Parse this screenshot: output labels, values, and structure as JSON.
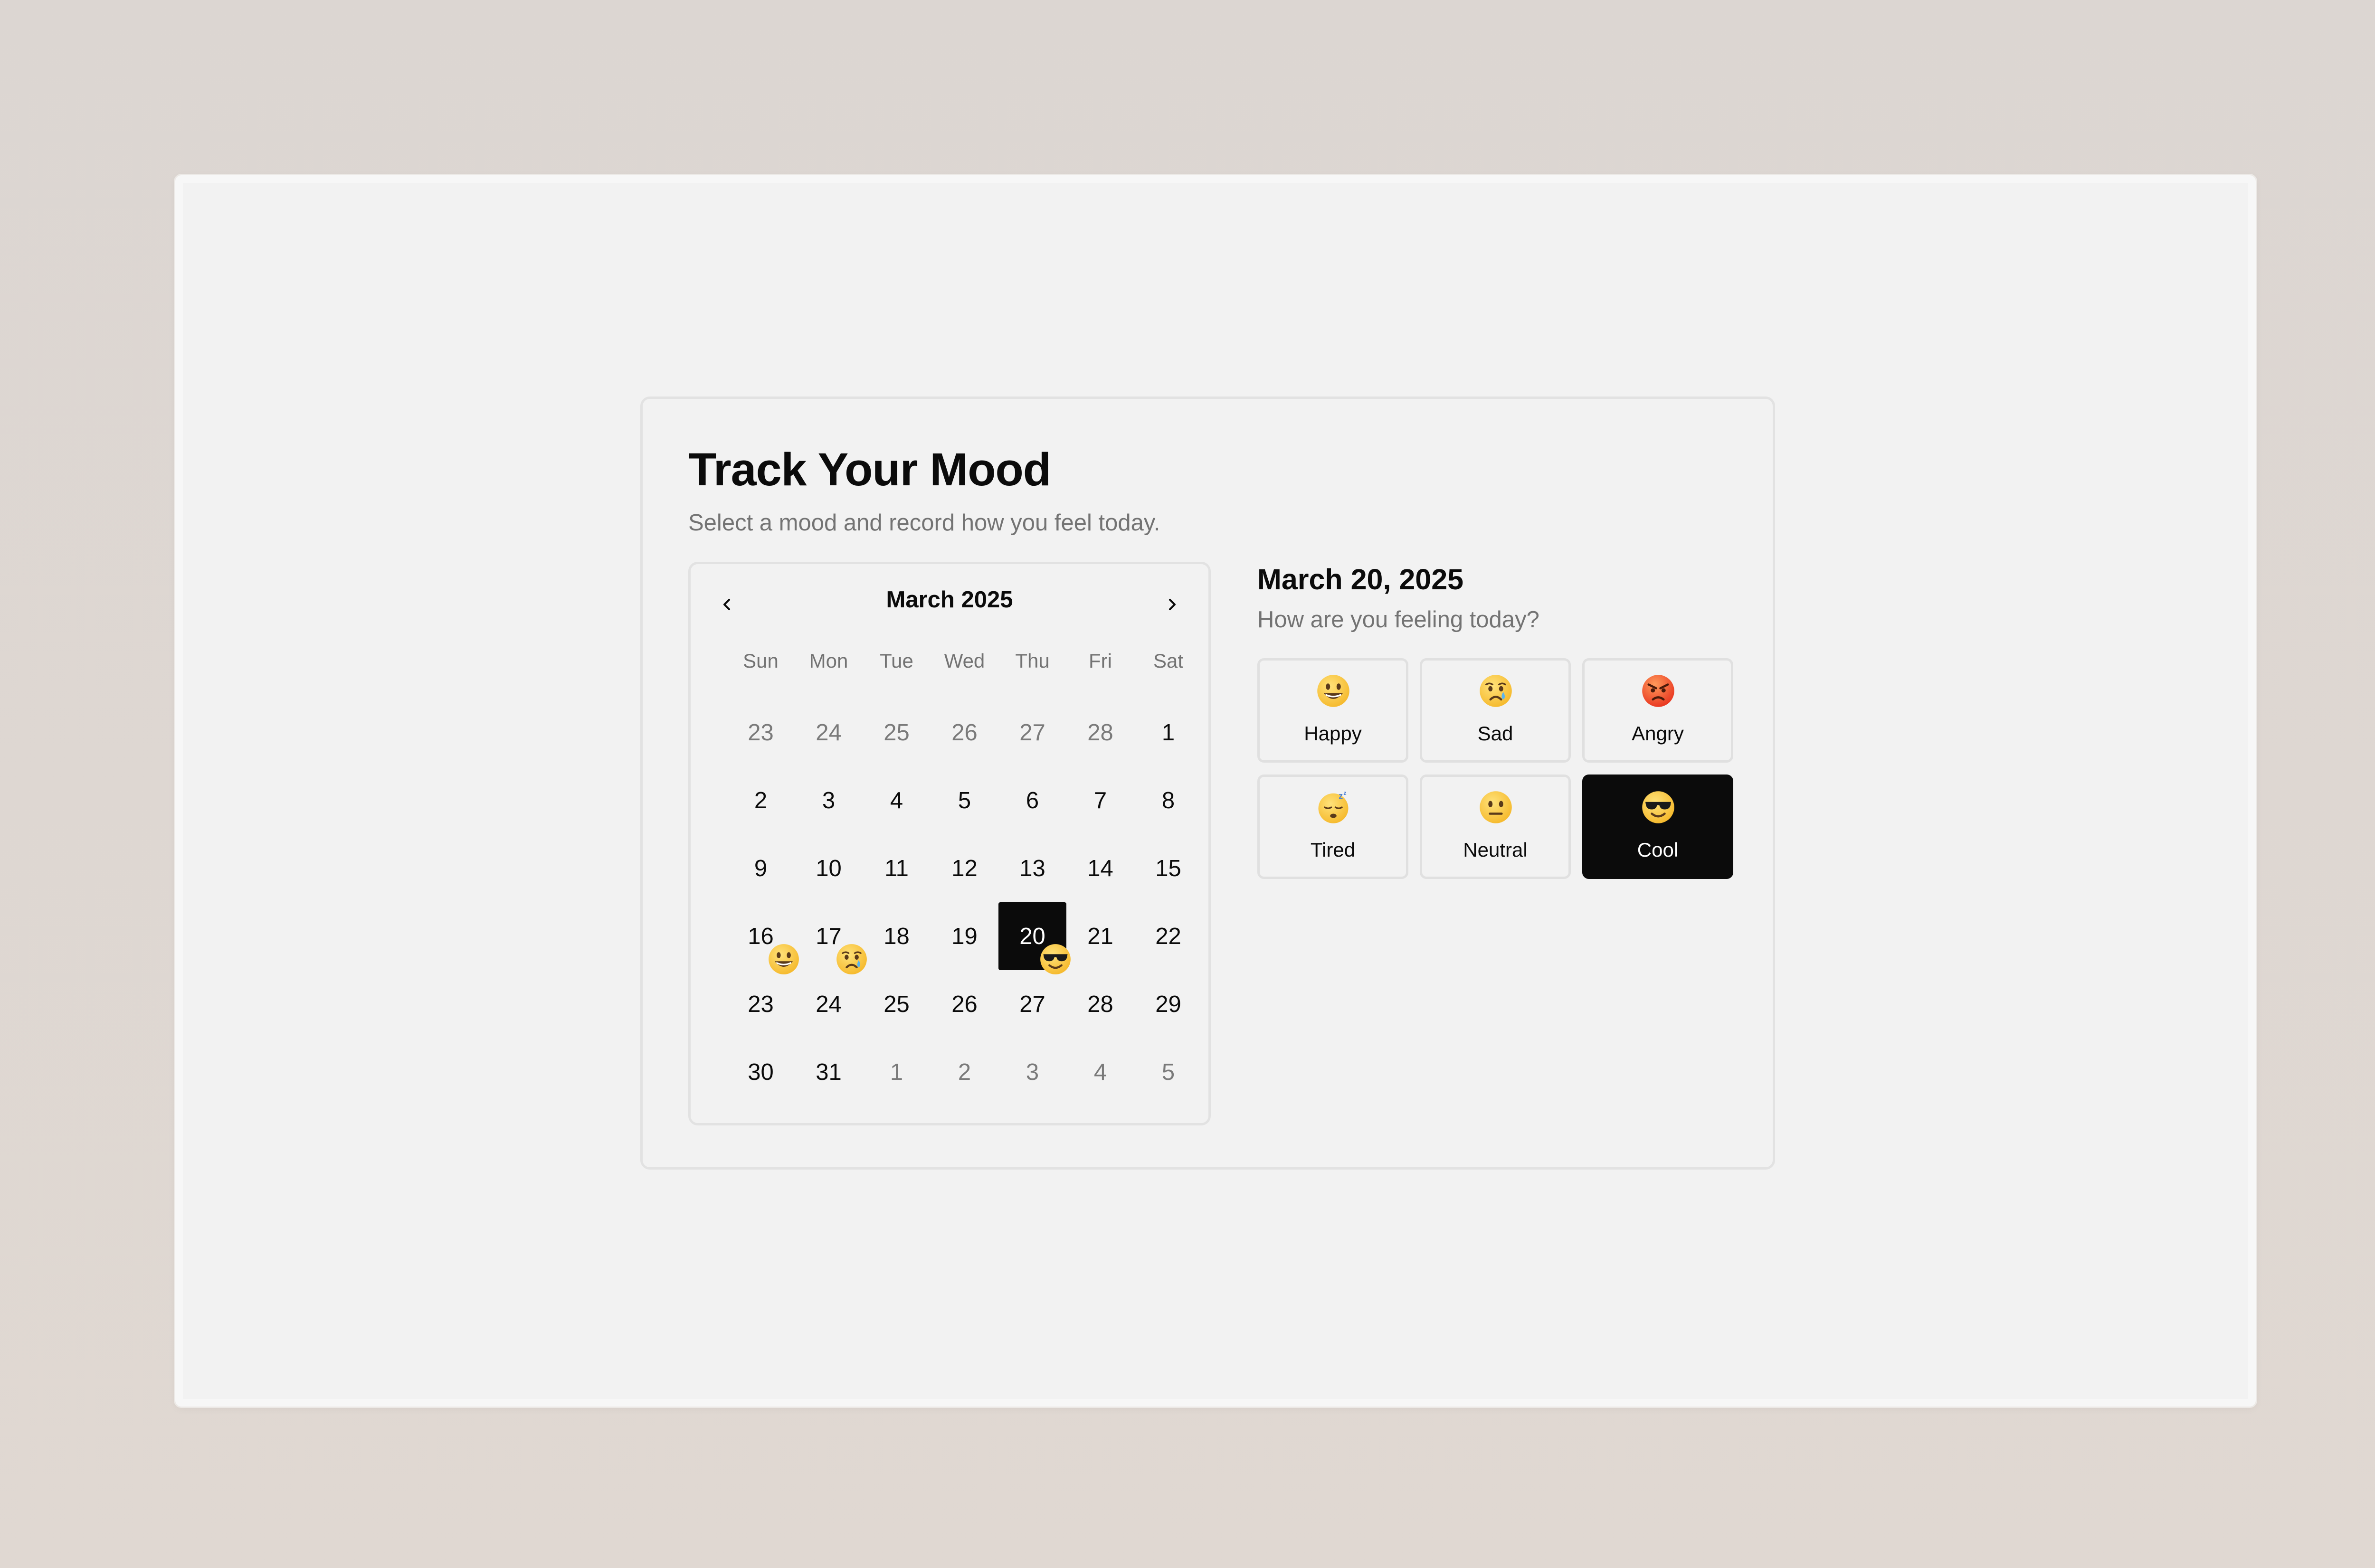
{
  "page": {
    "title": "Track Your Mood",
    "subtitle": "Select a mood and record how you feel today."
  },
  "calendar": {
    "month_label": "March 2025",
    "prev_icon": "chevron-left-icon",
    "next_icon": "chevron-right-icon",
    "weekdays": [
      "Sun",
      "Mon",
      "Tue",
      "Wed",
      "Thu",
      "Fri",
      "Sat"
    ],
    "days": [
      {
        "label": "23",
        "outside": true
      },
      {
        "label": "24",
        "outside": true
      },
      {
        "label": "25",
        "outside": true
      },
      {
        "label": "26",
        "outside": true
      },
      {
        "label": "27",
        "outside": true
      },
      {
        "label": "28",
        "outside": true
      },
      {
        "label": "1"
      },
      {
        "label": "2"
      },
      {
        "label": "3"
      },
      {
        "label": "4"
      },
      {
        "label": "5"
      },
      {
        "label": "6"
      },
      {
        "label": "7"
      },
      {
        "label": "8"
      },
      {
        "label": "9"
      },
      {
        "label": "10"
      },
      {
        "label": "11"
      },
      {
        "label": "12"
      },
      {
        "label": "13"
      },
      {
        "label": "14"
      },
      {
        "label": "15"
      },
      {
        "label": "16",
        "mood": "happy"
      },
      {
        "label": "17",
        "mood": "sad"
      },
      {
        "label": "18"
      },
      {
        "label": "19"
      },
      {
        "label": "20",
        "selected": true,
        "mood": "cool"
      },
      {
        "label": "21"
      },
      {
        "label": "22"
      },
      {
        "label": "23"
      },
      {
        "label": "24"
      },
      {
        "label": "25"
      },
      {
        "label": "26"
      },
      {
        "label": "27"
      },
      {
        "label": "28"
      },
      {
        "label": "29"
      },
      {
        "label": "30"
      },
      {
        "label": "31"
      },
      {
        "label": "1",
        "outside": true
      },
      {
        "label": "2",
        "outside": true
      },
      {
        "label": "3",
        "outside": true
      },
      {
        "label": "4",
        "outside": true
      },
      {
        "label": "5",
        "outside": true
      }
    ]
  },
  "selection": {
    "date": "March 20, 2025",
    "question": "How are you feeling today?"
  },
  "moods": [
    {
      "id": "happy",
      "label": "Happy",
      "icon": "happy-face-icon"
    },
    {
      "id": "sad",
      "label": "Sad",
      "icon": "crying-face-icon"
    },
    {
      "id": "angry",
      "label": "Angry",
      "icon": "angry-face-icon"
    },
    {
      "id": "tired",
      "label": "Tired",
      "icon": "sleeping-face-icon"
    },
    {
      "id": "neutral",
      "label": "Neutral",
      "icon": "neutral-face-icon"
    },
    {
      "id": "cool",
      "label": "Cool",
      "icon": "sunglasses-face-icon",
      "selected": true
    }
  ],
  "colors": {
    "accent": "#0b0b0b",
    "muted_text": "#737373",
    "border": "#e2e2e2",
    "surface": "#f2f2f2"
  }
}
